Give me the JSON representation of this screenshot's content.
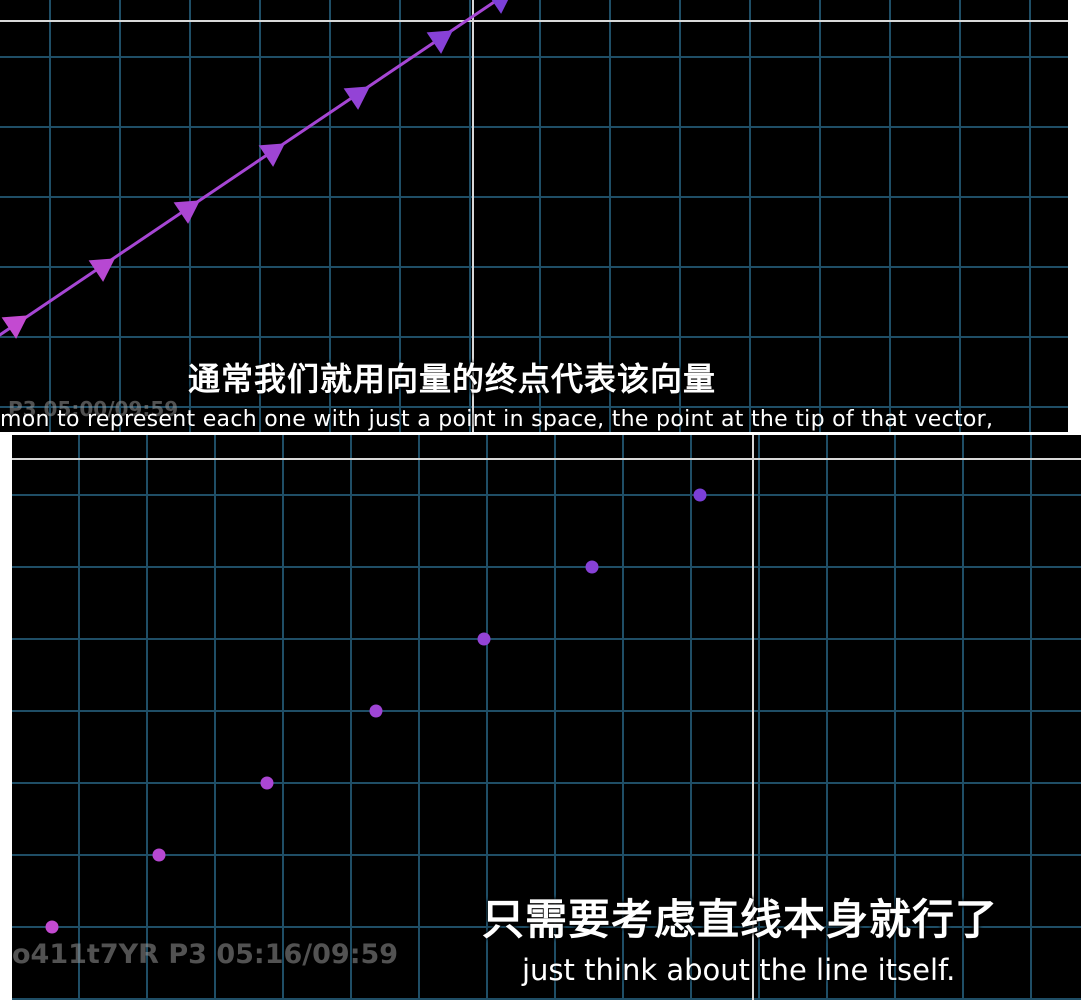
{
  "top_clip": {
    "subtitle_cn": "通常我们就用向量的终点代表该向量",
    "subtitle_en": "mon to represent each one with just a point in space, the point at the tip of that vector,",
    "timestamp": "P3 05:00/09:59"
  },
  "bottom_clip": {
    "subtitle_cn": "只需要考虑直线本身就行了",
    "subtitle_en": "just think about the line itself.",
    "timestamp": "o411t7YR P3 05:16/09:59"
  },
  "colors": {
    "background": "#000000",
    "grid": "#1f4e66",
    "axis": "#d8d8d8",
    "vector_start": "#c34ad1",
    "vector_end": "#7b3fd8"
  }
}
